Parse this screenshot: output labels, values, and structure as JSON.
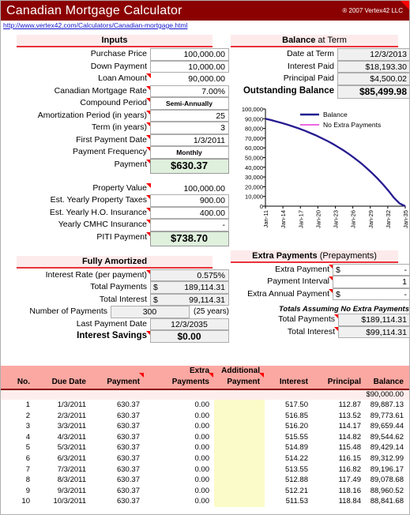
{
  "window": {
    "title": "Canadian Mortgage Calculator",
    "copyright": "® 2007 Vertex42 LLC",
    "url": "http://www.vertex42.com/Calculators/Canadian-mortgage.html"
  },
  "inputs": {
    "header": "Inputs",
    "rows": [
      {
        "label": "Purchase Price",
        "value": "100,000.00",
        "kind": "input"
      },
      {
        "label": "Down Payment",
        "value": "10,000.00",
        "kind": "input"
      },
      {
        "label": "Loan Amount",
        "value": "90,000.00",
        "kind": "plain"
      },
      {
        "label": "Canadian Mortgage Rate",
        "value": "7.00%",
        "kind": "input"
      },
      {
        "label": "Compound Period",
        "value": "Semi-Annually",
        "kind": "input"
      },
      {
        "label": "Amortization Period (in years)",
        "value": "25",
        "kind": "input"
      },
      {
        "label": "Term (in years)",
        "value": "3",
        "kind": "input"
      },
      {
        "label": "First Payment Date",
        "value": "1/3/2011",
        "kind": "input"
      },
      {
        "label": "Payment Frequency",
        "value": "Monthly",
        "kind": "input"
      },
      {
        "label": "Payment",
        "value": "$630.37",
        "kind": "green"
      }
    ]
  },
  "property": {
    "rows": [
      {
        "label": "Property Value",
        "value": "100,000.00",
        "kind": "plain"
      },
      {
        "label": "Est. Yearly Property Taxes",
        "value": "900.00",
        "kind": "input"
      },
      {
        "label": "Est. Yearly H.O. Insurance",
        "value": "400.00",
        "kind": "input"
      },
      {
        "label": "Yearly CMHC Insurance",
        "value": "-",
        "kind": "input"
      },
      {
        "label": "PITI Payment",
        "value": "$738.70",
        "kind": "green"
      }
    ]
  },
  "balance_at_term": {
    "header_bold": "Balance",
    "header_rest": " at Term",
    "rows": [
      {
        "label": "Date at Term",
        "value": "12/3/2013"
      },
      {
        "label": "Interest Paid",
        "value": "$18,193.30"
      },
      {
        "label": "Principal Paid",
        "value": "$4,500.02"
      },
      {
        "label": "Outstanding Balance",
        "value": "$85,499.98"
      }
    ]
  },
  "fully_amortized": {
    "header": "Fully Amortized",
    "note": "(25 years)",
    "rows": [
      {
        "label": "Interest Rate (per payment)",
        "value": "0.575%"
      },
      {
        "label": "Total Payments",
        "value": "$ 189,114.31"
      },
      {
        "label": "Total Interest",
        "value": "$  99,114.31"
      },
      {
        "label": "Number of Payments",
        "value": "300"
      },
      {
        "label": "Last Payment Date",
        "value": "12/3/2035"
      },
      {
        "label": "Interest Savings",
        "value": "$0.00"
      }
    ]
  },
  "extra_payments": {
    "header_bold": "Extra Payments",
    "header_rest": " (Prepayments)",
    "rows": [
      {
        "label": "Extra Payment",
        "prefix": "$",
        "value": "-"
      },
      {
        "label": "Payment Interval",
        "prefix": "",
        "value": "1"
      },
      {
        "label": "Extra Annual Payment",
        "prefix": "$",
        "value": "-"
      }
    ],
    "totals_note": "Totals Assuming No Extra Payments",
    "totals": [
      {
        "label": "Total Payments",
        "value": "$189,114.31"
      },
      {
        "label": "Total Interest",
        "value": "$99,114.31"
      }
    ]
  },
  "amortization_table": {
    "headers_line1": [
      "",
      "",
      "",
      "Extra",
      "Additional",
      "",
      "",
      ""
    ],
    "headers_line2": [
      "No.",
      "Due Date",
      "Payment",
      "Payments",
      "Payment",
      "Interest",
      "Principal",
      "Balance"
    ],
    "opening_balance": "$90,000.00",
    "rows": [
      {
        "no": "1",
        "date": "1/3/2011",
        "payment": "630.37",
        "extra": "0.00",
        "additional": "",
        "interest": "517.50",
        "principal": "112.87",
        "balance": "89,887.13"
      },
      {
        "no": "2",
        "date": "2/3/2011",
        "payment": "630.37",
        "extra": "0.00",
        "additional": "",
        "interest": "516.85",
        "principal": "113.52",
        "balance": "89,773.61"
      },
      {
        "no": "3",
        "date": "3/3/2011",
        "payment": "630.37",
        "extra": "0.00",
        "additional": "",
        "interest": "516.20",
        "principal": "114.17",
        "balance": "89,659.44"
      },
      {
        "no": "4",
        "date": "4/3/2011",
        "payment": "630.37",
        "extra": "0.00",
        "additional": "",
        "interest": "515.55",
        "principal": "114.82",
        "balance": "89,544.62"
      },
      {
        "no": "5",
        "date": "5/3/2011",
        "payment": "630.37",
        "extra": "0.00",
        "additional": "",
        "interest": "514.89",
        "principal": "115.48",
        "balance": "89,429.14"
      },
      {
        "no": "6",
        "date": "6/3/2011",
        "payment": "630.37",
        "extra": "0.00",
        "additional": "",
        "interest": "514.22",
        "principal": "116.15",
        "balance": "89,312.99"
      },
      {
        "no": "7",
        "date": "7/3/2011",
        "payment": "630.37",
        "extra": "0.00",
        "additional": "",
        "interest": "513.55",
        "principal": "116.82",
        "balance": "89,196.17"
      },
      {
        "no": "8",
        "date": "8/3/2011",
        "payment": "630.37",
        "extra": "0.00",
        "additional": "",
        "interest": "512.88",
        "principal": "117.49",
        "balance": "89,078.68"
      },
      {
        "no": "9",
        "date": "9/3/2011",
        "payment": "630.37",
        "extra": "0.00",
        "additional": "",
        "interest": "512.21",
        "principal": "118.16",
        "balance": "88,960.52"
      },
      {
        "no": "10",
        "date": "10/3/2011",
        "payment": "630.37",
        "extra": "0.00",
        "additional": "",
        "interest": "511.53",
        "principal": "118.84",
        "balance": "88,841.68"
      }
    ]
  },
  "chart_data": {
    "type": "line",
    "title": "",
    "xlabel": "",
    "ylabel": "",
    "grid": false,
    "legend_position": "top-right",
    "ylim": [
      0,
      100000
    ],
    "ytick_labels": [
      "100,000",
      "90,000",
      "80,000",
      "70,000",
      "60,000",
      "50,000",
      "40,000",
      "30,000",
      "20,000",
      "10,000",
      "0"
    ],
    "xtick_labels": [
      "Jan-11",
      "Jan-14",
      "Jan-17",
      "Jan-20",
      "Jan-23",
      "Jan-26",
      "Jan-29",
      "Jan-32",
      "Jan-35"
    ],
    "series": [
      {
        "name": "Balance",
        "color": "#1f1f8f",
        "x": [
          "Jan-11",
          "Jan-12",
          "Jan-13",
          "Jan-14",
          "Jan-15",
          "Jan-16",
          "Jan-17",
          "Jan-18",
          "Jan-19",
          "Jan-20",
          "Jan-21",
          "Jan-22",
          "Jan-23",
          "Jan-24",
          "Jan-25",
          "Jan-26",
          "Jan-27",
          "Jan-28",
          "Jan-29",
          "Jan-30",
          "Jan-31",
          "Jan-32",
          "Jan-33",
          "Jan-34",
          "Jan-35",
          "Dec-35"
        ],
        "values": [
          90000,
          88600,
          87100,
          85500,
          83800,
          81900,
          79900,
          77700,
          75400,
          72900,
          70200,
          67300,
          64200,
          60800,
          57200,
          53300,
          49100,
          44600,
          39700,
          34400,
          28700,
          22500,
          15800,
          8500,
          2800,
          0
        ]
      },
      {
        "name": "No Extra Payments",
        "color": "#ea33d8",
        "x": [
          "Jan-11",
          "Jan-12",
          "Jan-13",
          "Jan-14",
          "Jan-15",
          "Jan-16",
          "Jan-17",
          "Jan-18",
          "Jan-19",
          "Jan-20",
          "Jan-21",
          "Jan-22",
          "Jan-23",
          "Jan-24",
          "Jan-25",
          "Jan-26",
          "Jan-27",
          "Jan-28",
          "Jan-29",
          "Jan-30",
          "Jan-31",
          "Jan-32",
          "Jan-33",
          "Jan-34",
          "Jan-35",
          "Dec-35"
        ],
        "values": [
          90000,
          88600,
          87100,
          85500,
          83800,
          81900,
          79900,
          77700,
          75400,
          72900,
          70200,
          67300,
          64200,
          60800,
          57200,
          53300,
          49100,
          44600,
          39700,
          34400,
          28700,
          22500,
          15800,
          8500,
          2800,
          0
        ]
      }
    ]
  }
}
